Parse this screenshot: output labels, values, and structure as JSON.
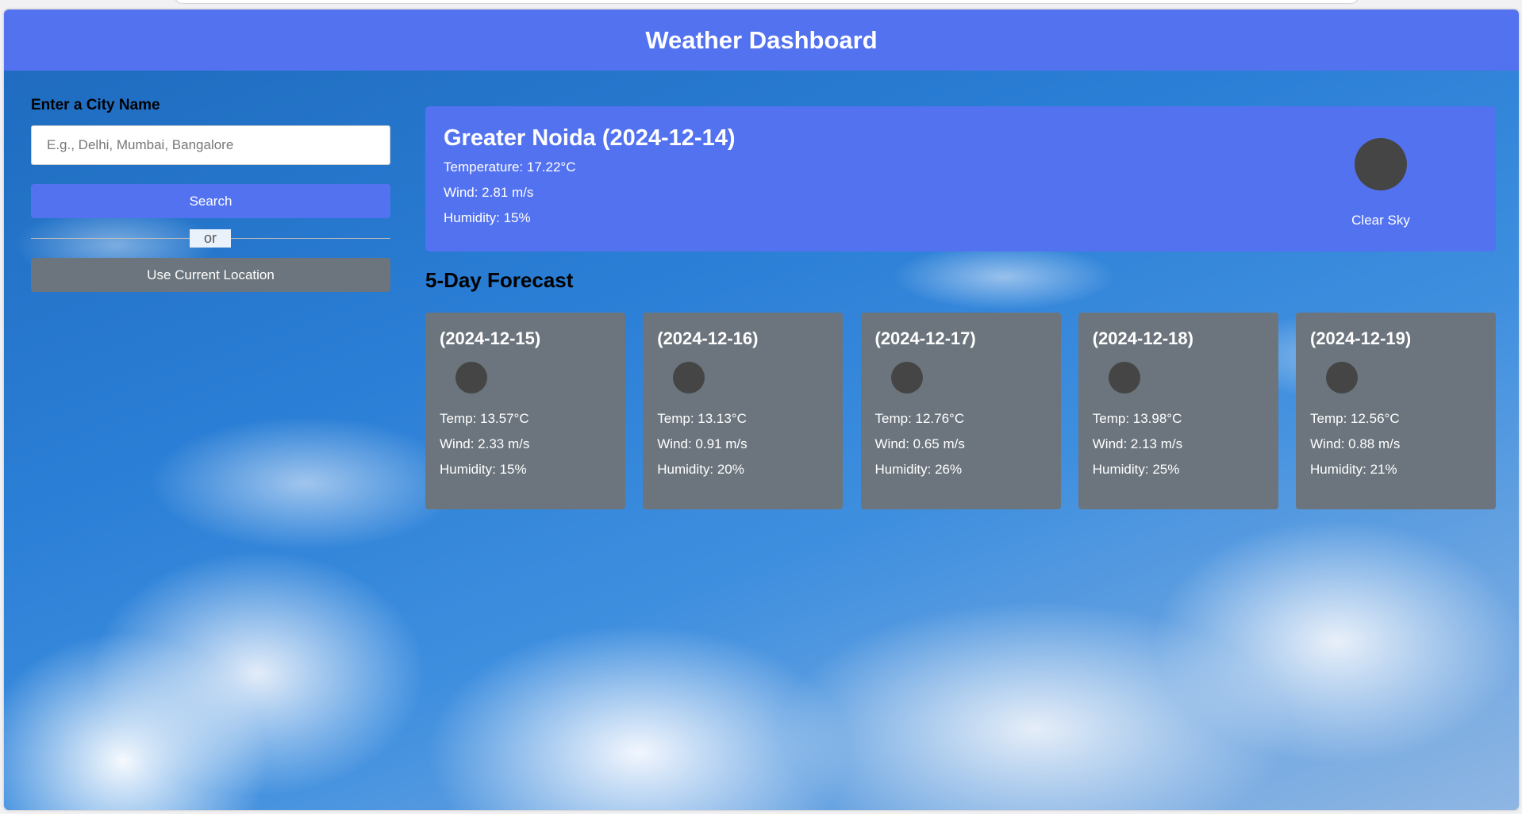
{
  "header": {
    "title": "Weather Dashboard"
  },
  "search": {
    "label": "Enter a City Name",
    "placeholder": "E.g., Delhi, Mumbai, Bangalore",
    "value": "",
    "search_button": "Search",
    "separator": "or",
    "location_button": "Use Current Location"
  },
  "current": {
    "title": "Greater Noida (2024-12-14)",
    "temperature": "Temperature: 17.22°C",
    "wind": "Wind: 2.81 m/s",
    "humidity": "Humidity: 15%",
    "icon": "weather-icon",
    "description": "Clear Sky"
  },
  "forecast": {
    "title": "5-Day Forecast",
    "days": [
      {
        "date": "(2024-12-15)",
        "temp": "Temp: 13.57°C",
        "wind": "Wind: 2.33 m/s",
        "humidity": "Humidity: 15%"
      },
      {
        "date": "(2024-12-16)",
        "temp": "Temp: 13.13°C",
        "wind": "Wind: 0.91 m/s",
        "humidity": "Humidity: 20%"
      },
      {
        "date": "(2024-12-17)",
        "temp": "Temp: 12.76°C",
        "wind": "Wind: 0.65 m/s",
        "humidity": "Humidity: 26%"
      },
      {
        "date": "(2024-12-18)",
        "temp": "Temp: 13.98°C",
        "wind": "Wind: 2.13 m/s",
        "humidity": "Humidity: 25%"
      },
      {
        "date": "(2024-12-19)",
        "temp": "Temp: 12.56°C",
        "wind": "Wind: 0.88 m/s",
        "humidity": "Humidity: 21%"
      }
    ]
  },
  "colors": {
    "primary": "#5372f0",
    "secondary": "#6c757d",
    "icon_placeholder": "#454545"
  }
}
